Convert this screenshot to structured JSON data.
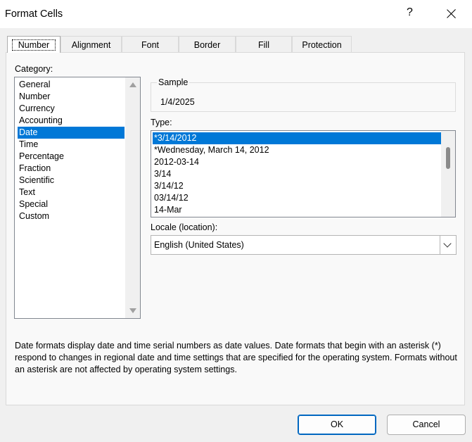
{
  "window": {
    "title": "Format Cells",
    "help": "?"
  },
  "tabs": [
    {
      "label": "Number"
    },
    {
      "label": "Alignment"
    },
    {
      "label": "Font"
    },
    {
      "label": "Border"
    },
    {
      "label": "Fill"
    },
    {
      "label": "Protection"
    }
  ],
  "category": {
    "label": "Category:",
    "items": [
      "General",
      "Number",
      "Currency",
      "Accounting",
      "Date",
      "Time",
      "Percentage",
      "Fraction",
      "Scientific",
      "Text",
      "Special",
      "Custom"
    ],
    "selected": "Date"
  },
  "sample": {
    "legend": "Sample",
    "value": "1/4/2025"
  },
  "type": {
    "label": "Type:",
    "items": [
      "*3/14/2012",
      "*Wednesday, March 14, 2012",
      "2012-03-14",
      "3/14",
      "3/14/12",
      "03/14/12",
      "14-Mar"
    ],
    "selected": "*3/14/2012"
  },
  "locale": {
    "label": "Locale (location):",
    "value": "English (United States)"
  },
  "description": "Date formats display date and time serial numbers as date values.  Date formats that begin with an asterisk (*) respond to changes in regional date and time settings that are specified for the operating system. Formats without an asterisk are not affected by operating system settings.",
  "buttons": {
    "ok": "OK",
    "cancel": "Cancel"
  },
  "colors": {
    "selection": "#0078d7",
    "default_button_border": "#0067c0"
  }
}
